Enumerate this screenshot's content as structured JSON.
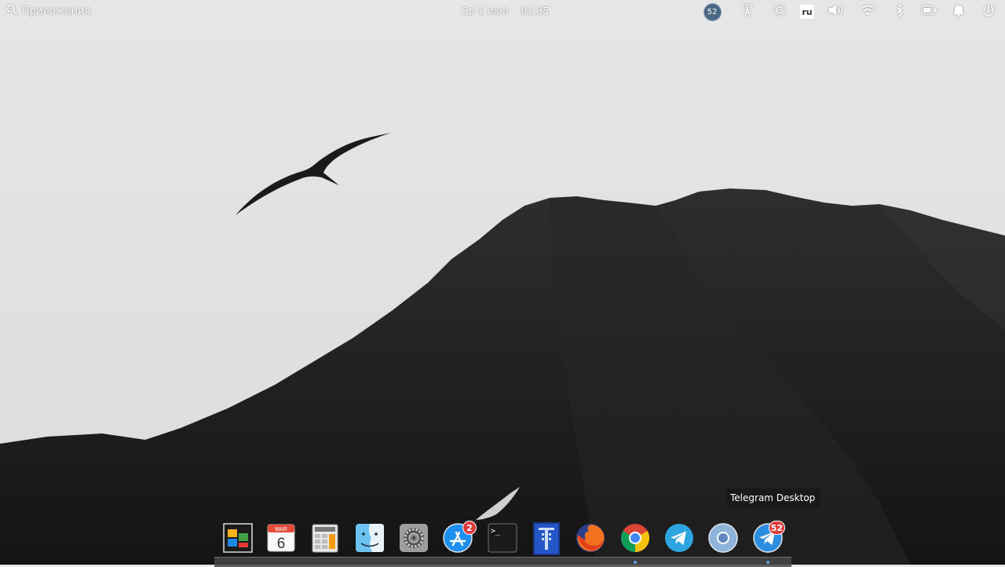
{
  "panel": {
    "apps_label": "Приложения",
    "date": "Ср 1 июл",
    "time": "01:35",
    "indicators": {
      "notifications_badge": "52",
      "keyboard_layout": "ru"
    }
  },
  "dock": {
    "items": [
      {
        "name": "file-manager",
        "icon": "windows-tiles-icon"
      },
      {
        "name": "calendar",
        "icon": "calendar-icon",
        "month": "MAR",
        "day": "6"
      },
      {
        "name": "calculator",
        "icon": "calculator-icon"
      },
      {
        "name": "finder",
        "icon": "finder-face-icon"
      },
      {
        "name": "system-settings",
        "icon": "gear-icon"
      },
      {
        "name": "app-store",
        "icon": "app-store-icon",
        "badge": "2"
      },
      {
        "name": "terminal",
        "icon": "terminal-icon",
        "prompt": ">_"
      },
      {
        "name": "typora",
        "icon": "typora-icon"
      },
      {
        "name": "firefox",
        "icon": "firefox-icon"
      },
      {
        "name": "chrome",
        "icon": "chrome-icon"
      },
      {
        "name": "telegram",
        "icon": "telegram-icon"
      },
      {
        "name": "chromium",
        "icon": "chromium-icon"
      },
      {
        "name": "telegram-desktop",
        "icon": "telegram-icon",
        "badge": "52"
      }
    ],
    "tooltip": "Telegram Desktop"
  },
  "colors": {
    "sky": "#e9e9e9",
    "mountain": "#1c1c1c",
    "badge_red": "#e03a3a",
    "telegram_blue": "#2ca5e0"
  }
}
